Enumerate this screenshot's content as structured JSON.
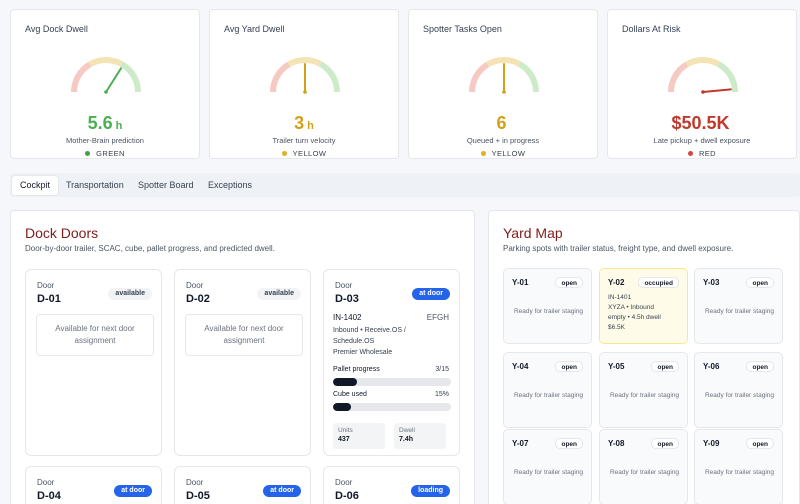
{
  "kpis": [
    {
      "title": "Avg Dock Dwell",
      "value": "5.6",
      "unit": "h",
      "subtitle": "Mother-Brain prediction",
      "status": "GREEN",
      "value_color": "#4caf50",
      "status_color": "#43a047",
      "needle_fraction": 0.68
    },
    {
      "title": "Avg Yard Dwell",
      "value": "3",
      "unit": "h",
      "subtitle": "Trailer turn velocity",
      "status": "YELLOW",
      "value_color": "#d4a017",
      "status_color": "#e0b020",
      "needle_fraction": 0.5
    },
    {
      "title": "Spotter Tasks Open",
      "value": "6",
      "unit": "",
      "subtitle": "Queued + in progress",
      "status": "YELLOW",
      "value_color": "#d4a017",
      "status_color": "#e0b020",
      "needle_fraction": 0.5
    },
    {
      "title": "Dollars At Risk",
      "value": "$50.5K",
      "unit": "",
      "subtitle": "Late pickup + dwell exposure",
      "status": "RED",
      "value_color": "#c0392b",
      "status_color": "#d64541",
      "needle_fraction": 0.97
    }
  ],
  "tabs": [
    "Cockpit",
    "Transportation",
    "Spotter Board",
    "Exceptions"
  ],
  "dock": {
    "title": "Dock Doors",
    "subtitle": "Door-by-door trailer, SCAC, cube, pallet progress, and predicted dwell.",
    "door_label": "Door",
    "doors": [
      {
        "id": "D-01",
        "badge": "available",
        "note": "Available for next door assignment"
      },
      {
        "id": "D-02",
        "badge": "available",
        "note": "Available for next door assignment"
      },
      {
        "id": "D-03",
        "badge": "at door",
        "load": "IN-1402",
        "scac": "EFGH",
        "meta1": "Inbound • Receive.OS /",
        "meta2": "Schedule.OS",
        "meta3": "Premier Wholesale",
        "pallet_label": "Pallet progress",
        "pallet_value": "3/15",
        "pallet_fraction": 0.2,
        "cube_label": "Cube used",
        "cube_value": "15%",
        "cube_fraction": 0.15,
        "units_label": "Units",
        "units_value": "437",
        "dwell_label": "Dwell",
        "dwell_value": "7.4h"
      },
      {
        "id": "D-04",
        "badge": "at door"
      },
      {
        "id": "D-05",
        "badge": "at door"
      },
      {
        "id": "D-06",
        "badge": "loading"
      }
    ]
  },
  "yard": {
    "title": "Yard Map",
    "subtitle": "Parking spots with trailer status, freight type, and dwell exposure.",
    "empty_text": "Ready for trailer staging",
    "spots": [
      {
        "id": "Y-01",
        "status": "open"
      },
      {
        "id": "Y-02",
        "status": "occupied",
        "line1": "IN-1401",
        "line2": "XYZA • Inbound",
        "line3": "empty • 4.5h dwell",
        "line4": "$6.5K"
      },
      {
        "id": "Y-03",
        "status": "open"
      },
      {
        "id": "Y-04",
        "status": "open"
      },
      {
        "id": "Y-05",
        "status": "open"
      },
      {
        "id": "Y-06",
        "status": "open"
      },
      {
        "id": "Y-07",
        "status": "open"
      },
      {
        "id": "Y-08",
        "status": "open"
      },
      {
        "id": "Y-09",
        "status": "open"
      }
    ]
  }
}
